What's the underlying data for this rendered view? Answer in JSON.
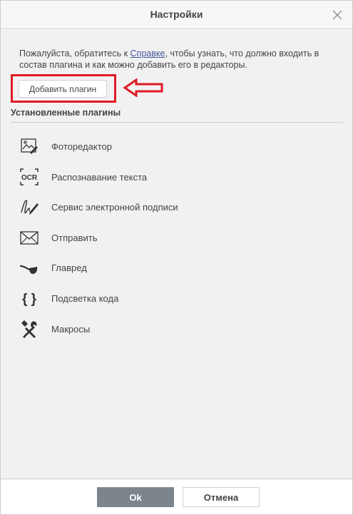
{
  "dialog": {
    "title": "Настройки",
    "close_icon": "close-icon"
  },
  "intro": {
    "text_before": "Пожалуйста, обратитесь к ",
    "link": "Справке",
    "text_after": ", чтобы узнать, что должно входить в состав плагина и как можно добавить его в редакторы."
  },
  "add_plugin_label": "Добавить плагин",
  "annotation_color": "#e01b24",
  "installed_title": "Установленные плагины",
  "plugins": [
    {
      "label": "Фоторедактор",
      "icon": "photo-editor-icon"
    },
    {
      "label": "Распознавание текста",
      "icon": "ocr-icon",
      "icon_text": "OCR"
    },
    {
      "label": "Сервис электронной подписи",
      "icon": "signature-pen-icon"
    },
    {
      "label": "Отправить",
      "icon": "envelope-icon"
    },
    {
      "label": "Главред",
      "icon": "pipe-icon"
    },
    {
      "label": "Подсветка кода",
      "icon": "curly-braces-icon",
      "icon_text": "{ }"
    },
    {
      "label": "Макросы",
      "icon": "tools-icon"
    }
  ],
  "footer": {
    "ok_label": "Ok",
    "cancel_label": "Отмена",
    "ok_color": "#7d858c"
  }
}
